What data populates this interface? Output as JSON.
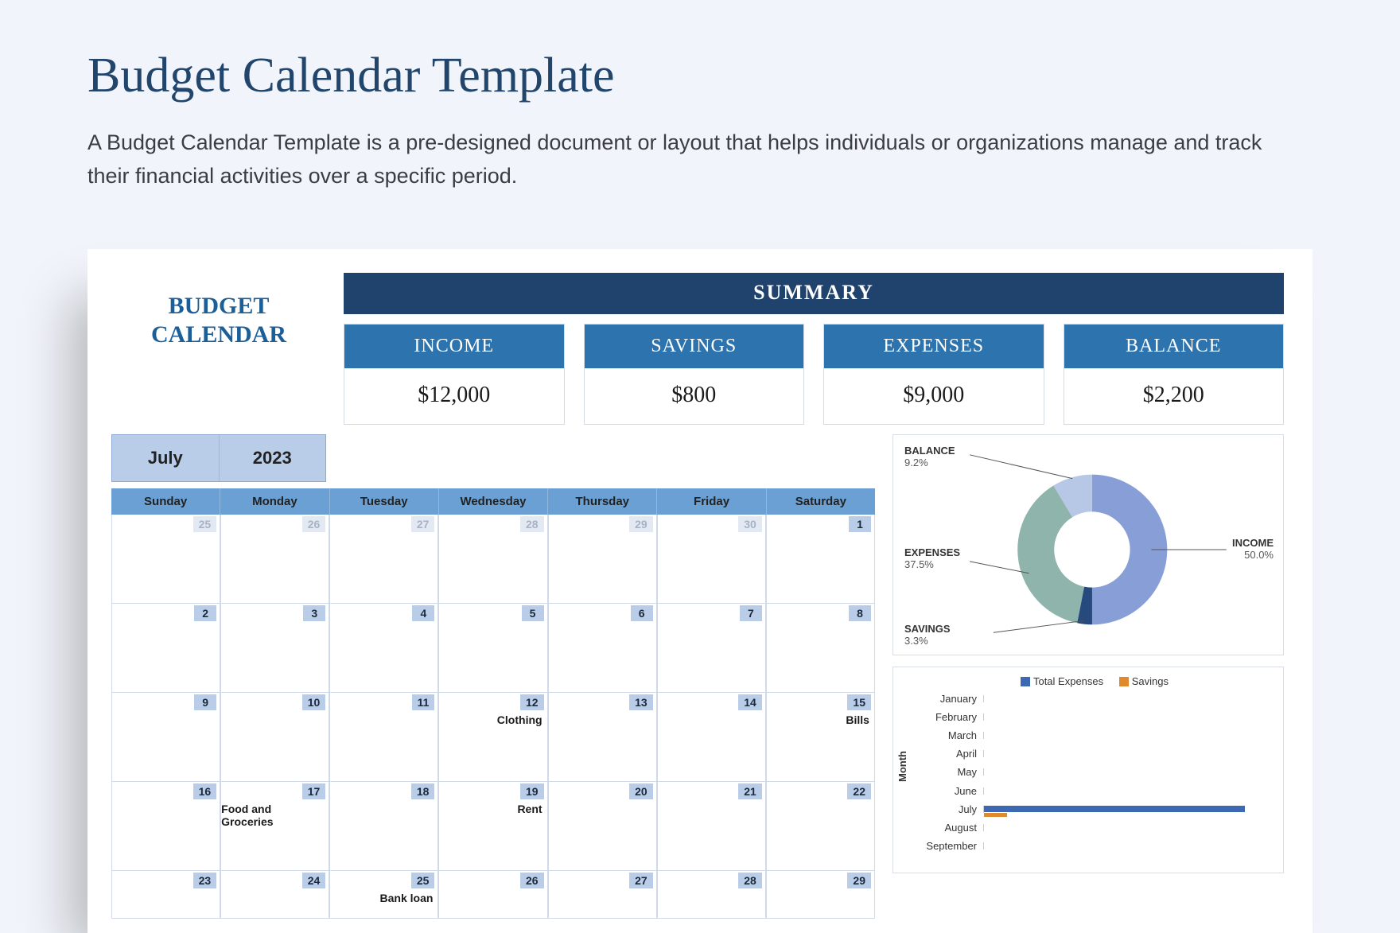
{
  "page": {
    "title": "Budget Calendar Template",
    "description": "A Budget Calendar Template is a pre-designed document or layout that helps individuals or organizations manage and track their financial activities over a specific period."
  },
  "badge": {
    "line1": "BUDGET",
    "line2": "CALENDAR"
  },
  "month": {
    "name": "July",
    "year": "2023"
  },
  "summary": {
    "title": "SUMMARY",
    "cards": [
      {
        "label": "INCOME",
        "value": "$12,000"
      },
      {
        "label": "SAVINGS",
        "value": "$800"
      },
      {
        "label": "EXPENSES",
        "value": "$9,000"
      },
      {
        "label": "BALANCE",
        "value": "$2,200"
      }
    ]
  },
  "calendar": {
    "days": [
      "Sunday",
      "Monday",
      "Tuesday",
      "Wednesday",
      "Thursday",
      "Friday",
      "Saturday"
    ],
    "weeks": [
      [
        {
          "n": "25",
          "faded": true
        },
        {
          "n": "26",
          "faded": true
        },
        {
          "n": "27",
          "faded": true
        },
        {
          "n": "28",
          "faded": true
        },
        {
          "n": "29",
          "faded": true
        },
        {
          "n": "30",
          "faded": true
        },
        {
          "n": "1"
        }
      ],
      [
        {
          "n": "2"
        },
        {
          "n": "3"
        },
        {
          "n": "4"
        },
        {
          "n": "5"
        },
        {
          "n": "6"
        },
        {
          "n": "7"
        },
        {
          "n": "8"
        }
      ],
      [
        {
          "n": "9"
        },
        {
          "n": "10"
        },
        {
          "n": "11"
        },
        {
          "n": "12",
          "ev": "Clothing"
        },
        {
          "n": "13"
        },
        {
          "n": "14"
        },
        {
          "n": "15",
          "ev": "Bills"
        }
      ],
      [
        {
          "n": "16"
        },
        {
          "n": "17",
          "ev": "Food and Groceries"
        },
        {
          "n": "18"
        },
        {
          "n": "19",
          "ev": "Rent"
        },
        {
          "n": "20"
        },
        {
          "n": "21"
        },
        {
          "n": "22"
        }
      ],
      [
        {
          "n": "23"
        },
        {
          "n": "24"
        },
        {
          "n": "25",
          "ev": "Bank loan"
        },
        {
          "n": "26"
        },
        {
          "n": "27"
        },
        {
          "n": "28"
        },
        {
          "n": "29"
        }
      ]
    ]
  },
  "chart_data": [
    {
      "type": "pie",
      "title": "",
      "series": [
        {
          "name": "INCOME",
          "value": 50.0,
          "color": "#879fd6"
        },
        {
          "name": "SAVINGS",
          "value": 3.3,
          "color": "#26497e"
        },
        {
          "name": "EXPENSES",
          "value": 37.5,
          "color": "#8fb4ab"
        },
        {
          "name": "BALANCE",
          "value": 9.2,
          "color": "#b7c7e6"
        }
      ]
    },
    {
      "type": "bar",
      "orientation": "horizontal",
      "ylabel": "Month",
      "legend": [
        "Total Expenses",
        "Savings"
      ],
      "legend_colors": [
        "#3d69b2",
        "#e08a2e"
      ],
      "categories": [
        "January",
        "February",
        "March",
        "April",
        "May",
        "June",
        "July",
        "August",
        "September"
      ],
      "series": [
        {
          "name": "Total Expenses",
          "values": [
            0,
            0,
            0,
            0,
            0,
            0,
            9000,
            0,
            0
          ]
        },
        {
          "name": "Savings",
          "values": [
            0,
            0,
            0,
            0,
            0,
            0,
            800,
            0,
            0
          ]
        }
      ],
      "xlim": [
        0,
        10000
      ]
    }
  ],
  "donut_labels": {
    "balance": "BALANCE",
    "balance_pct": "9.2%",
    "income": "INCOME",
    "income_pct": "50.0%",
    "expenses": "EXPENSES",
    "expenses_pct": "37.5%",
    "savings": "SAVINGS",
    "savings_pct": "3.3%"
  }
}
